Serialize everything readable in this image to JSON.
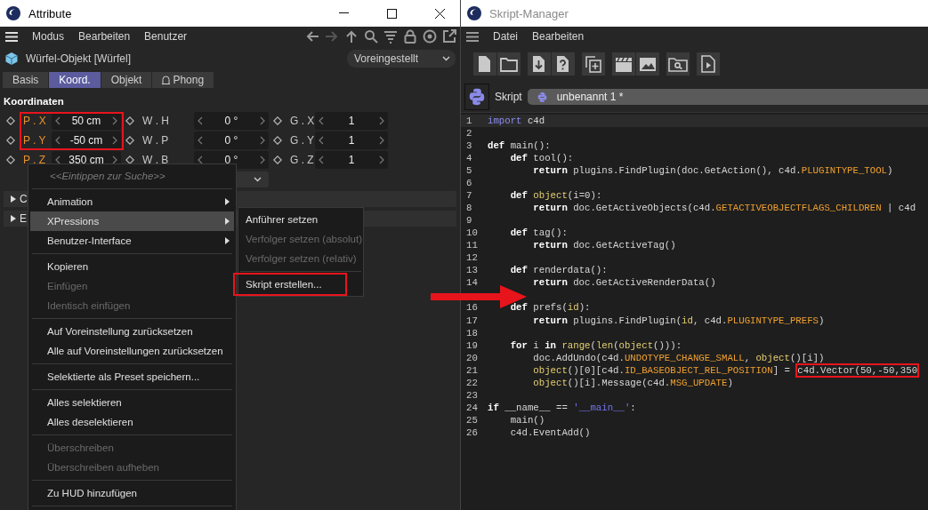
{
  "attribute_window": {
    "title": "Attribute",
    "menu": [
      "Modus",
      "Bearbeiten",
      "Benutzer"
    ],
    "object_title": "Würfel-Objekt [Würfel]",
    "preset": "Voreingestellt",
    "tabs": [
      {
        "label": "Basis",
        "selected": false,
        "has_icon": false
      },
      {
        "label": "Koord.",
        "selected": true,
        "has_icon": false
      },
      {
        "label": "Objekt",
        "selected": false,
        "has_icon": false
      },
      {
        "label": "Phong",
        "selected": false,
        "has_icon": true
      }
    ],
    "section_title": "Koordinaten",
    "coordinates": [
      [
        {
          "label": "P . X",
          "value": "50 cm",
          "color": "#e8902a",
          "annotated": true
        },
        {
          "label": "W . H",
          "value": "0 °",
          "color": "#c8c8c8",
          "annotated": false
        },
        {
          "label": "G . X",
          "value": "1",
          "color": "#c8c8c8",
          "annotated": false
        }
      ],
      [
        {
          "label": "P . Y",
          "value": "-50 cm",
          "color": "#e8902a",
          "annotated": true
        },
        {
          "label": "W . P",
          "value": "0 °",
          "color": "#c8c8c8",
          "annotated": false
        },
        {
          "label": "G . Y",
          "value": "1",
          "color": "#c8c8c8",
          "annotated": false
        }
      ],
      [
        {
          "label": "P . Z",
          "value": "350 cm",
          "color": "#e8902a",
          "annotated": false
        },
        {
          "label": "W . B",
          "value": "0 °",
          "color": "#c8c8c8",
          "annotated": false
        },
        {
          "label": "G . Z",
          "value": "1",
          "color": "#c8c8c8",
          "annotated": false
        }
      ]
    ],
    "groups": [
      {
        "label": "C",
        "expanded": false
      },
      {
        "label": "E",
        "expanded": false
      }
    ]
  },
  "context_menu": {
    "items": [
      {
        "kind": "search",
        "placeholder": "<<Eintippen zur Suche>>"
      },
      {
        "kind": "separator"
      },
      {
        "kind": "item",
        "label": "Animation",
        "submenu": true,
        "selected": false,
        "disabled": false
      },
      {
        "kind": "item",
        "label": "XPressions",
        "submenu": true,
        "selected": true,
        "disabled": false
      },
      {
        "kind": "item",
        "label": "Benutzer-Interface",
        "submenu": true,
        "selected": false,
        "disabled": false
      },
      {
        "kind": "separator"
      },
      {
        "kind": "item",
        "label": "Kopieren",
        "submenu": false,
        "selected": false,
        "disabled": false
      },
      {
        "kind": "item",
        "label": "Einfügen",
        "submenu": false,
        "selected": false,
        "disabled": true
      },
      {
        "kind": "item",
        "label": "Identisch einfügen",
        "submenu": false,
        "selected": false,
        "disabled": true
      },
      {
        "kind": "separator"
      },
      {
        "kind": "item",
        "label": "Auf Voreinstellung zurücksetzen",
        "submenu": false,
        "selected": false,
        "disabled": false
      },
      {
        "kind": "item",
        "label": "Alle auf Voreinstellungen zurücksetzen",
        "submenu": false,
        "selected": false,
        "disabled": false
      },
      {
        "kind": "separator"
      },
      {
        "kind": "item",
        "label": "Selektierte als Preset speichern...",
        "submenu": false,
        "selected": false,
        "disabled": false
      },
      {
        "kind": "separator"
      },
      {
        "kind": "item",
        "label": "Alles selektieren",
        "submenu": false,
        "selected": false,
        "disabled": false
      },
      {
        "kind": "item",
        "label": "Alles deselektieren",
        "submenu": false,
        "selected": false,
        "disabled": false
      },
      {
        "kind": "separator"
      },
      {
        "kind": "item",
        "label": "Überschreiben",
        "submenu": false,
        "selected": false,
        "disabled": true
      },
      {
        "kind": "item",
        "label": "Überschreiben aufheben",
        "submenu": false,
        "selected": false,
        "disabled": true
      },
      {
        "kind": "separator"
      },
      {
        "kind": "item",
        "label": "Zu HUD hinzufügen",
        "submenu": false,
        "selected": false,
        "disabled": false
      },
      {
        "kind": "separator"
      }
    ]
  },
  "submenu": {
    "items": [
      {
        "kind": "item",
        "label": "Anführer setzen",
        "disabled": false,
        "annotated": false
      },
      {
        "kind": "item",
        "label": "Verfolger setzen (absolut)",
        "disabled": true,
        "annotated": false
      },
      {
        "kind": "item",
        "label": "Verfolger setzen (relativ)",
        "disabled": true,
        "annotated": false
      },
      {
        "kind": "separator"
      },
      {
        "kind": "item",
        "label": "Skript erstellen...",
        "disabled": false,
        "annotated": true
      }
    ]
  },
  "script_window": {
    "title": "Skript-Manager",
    "menu": [
      "Datei",
      "Bearbeiten"
    ],
    "script_label": "Skript",
    "script_name": "unbenannt 1 *",
    "lines": [
      {
        "number": "1",
        "current": true,
        "tokens": [
          {
            "kind": "module",
            "text": "import"
          },
          {
            "kind": "plain",
            "text": " c4d"
          }
        ]
      },
      {
        "number": "2",
        "current": false
      },
      {
        "number": "3",
        "current": false,
        "tokens": [
          {
            "kind": "keyword",
            "text": "def"
          },
          {
            "kind": "plain",
            "text": " main():"
          }
        ]
      },
      {
        "number": "4",
        "current": false,
        "tokens": [
          {
            "kind": "keyword",
            "text": "    def"
          },
          {
            "kind": "plain",
            "text": " tool():"
          }
        ]
      },
      {
        "number": "5",
        "current": false,
        "tokens": [
          {
            "kind": "keyword",
            "text": "        return"
          },
          {
            "kind": "plain",
            "text": " plugins.FindPlugin(doc.GetAction(), c4d."
          },
          {
            "kind": "constant",
            "text": "PLUGINTYPE_TOOL"
          },
          {
            "kind": "plain",
            "text": ")"
          }
        ]
      },
      {
        "number": "6",
        "current": false
      },
      {
        "number": "7",
        "current": false,
        "tokens": [
          {
            "kind": "keyword",
            "text": "    def"
          },
          {
            "kind": "builtin",
            "text": " object"
          },
          {
            "kind": "plain",
            "text": "(i=0):"
          }
        ]
      },
      {
        "number": "8",
        "current": false,
        "tokens": [
          {
            "kind": "keyword",
            "text": "        return"
          },
          {
            "kind": "plain",
            "text": " doc.GetActiveObjects(c4d."
          },
          {
            "kind": "constant",
            "text": "GETACTIVEOBJECTFLAGS_CHILDREN"
          },
          {
            "kind": "plain",
            "text": " | c4d"
          }
        ]
      },
      {
        "number": "9",
        "current": false
      },
      {
        "number": "10",
        "current": false,
        "tokens": [
          {
            "kind": "keyword",
            "text": "    def"
          },
          {
            "kind": "plain",
            "text": " tag():"
          }
        ]
      },
      {
        "number": "11",
        "current": false,
        "tokens": [
          {
            "kind": "keyword",
            "text": "        return"
          },
          {
            "kind": "plain",
            "text": " doc.GetActiveTag()"
          }
        ]
      },
      {
        "number": "12",
        "current": false
      },
      {
        "number": "13",
        "current": false,
        "tokens": [
          {
            "kind": "keyword",
            "text": "    def"
          },
          {
            "kind": "plain",
            "text": " renderdata():"
          }
        ]
      },
      {
        "number": "14",
        "current": false,
        "tokens": [
          {
            "kind": "keyword",
            "text": "        return"
          },
          {
            "kind": "plain",
            "text": " doc.GetActiveRenderData()"
          }
        ]
      },
      {
        "current": false
      },
      {
        "number": "16",
        "current": false,
        "tokens": [
          {
            "kind": "keyword",
            "text": "    def"
          },
          {
            "kind": "plain",
            "text": " prefs("
          },
          {
            "kind": "builtin",
            "text": "id"
          },
          {
            "kind": "plain",
            "text": "):"
          }
        ]
      },
      {
        "number": "17",
        "current": false,
        "tokens": [
          {
            "kind": "keyword",
            "text": "        return"
          },
          {
            "kind": "plain",
            "text": " plugins.FindPlugin("
          },
          {
            "kind": "builtin",
            "text": "id"
          },
          {
            "kind": "plain",
            "text": ", c4d."
          },
          {
            "kind": "constant",
            "text": "PLUGINTYPE_PREFS"
          },
          {
            "kind": "plain",
            "text": ")"
          }
        ]
      },
      {
        "number": "18",
        "current": false
      },
      {
        "number": "19",
        "current": false,
        "tokens": [
          {
            "kind": "keyword",
            "text": "    for"
          },
          {
            "kind": "plain",
            "text": " i "
          },
          {
            "kind": "keyword",
            "text": "in"
          },
          {
            "kind": "builtin",
            "text": " range"
          },
          {
            "kind": "plain",
            "text": "("
          },
          {
            "kind": "builtin",
            "text": "len"
          },
          {
            "kind": "plain",
            "text": "("
          },
          {
            "kind": "builtin",
            "text": "object"
          },
          {
            "kind": "plain",
            "text": "())):"
          }
        ]
      },
      {
        "number": "20",
        "current": false,
        "tokens": [
          {
            "kind": "plain",
            "text": "        doc.AddUndo(c4d."
          },
          {
            "kind": "constant",
            "text": "UNDOTYPE_CHANGE_SMALL"
          },
          {
            "kind": "plain",
            "text": ", "
          },
          {
            "kind": "builtin",
            "text": "object"
          },
          {
            "kind": "plain",
            "text": "()[i])"
          }
        ]
      },
      {
        "number": "21",
        "current": false,
        "tokens": [
          {
            "kind": "builtin",
            "text": "        object"
          },
          {
            "kind": "plain",
            "text": "()[0][c4d."
          },
          {
            "kind": "constant",
            "text": "ID_BASEOBJECT_REL_POSITION"
          },
          {
            "kind": "plain",
            "text": "] = "
          },
          {
            "kind": "plain",
            "text": "c4d.Vector(50,-50,350",
            "annotated": true
          }
        ]
      },
      {
        "number": "22",
        "current": false,
        "tokens": [
          {
            "kind": "builtin",
            "text": "        object"
          },
          {
            "kind": "plain",
            "text": "()[i].Message(c4d."
          },
          {
            "kind": "constant",
            "text": "MSG_UPDATE"
          },
          {
            "kind": "plain",
            "text": ")"
          }
        ]
      },
      {
        "number": "23",
        "current": false
      },
      {
        "number": "24",
        "current": false,
        "tokens": [
          {
            "kind": "keyword",
            "text": "if"
          },
          {
            "kind": "plain",
            "text": " __name__ == "
          },
          {
            "kind": "string",
            "text": "'__main__'"
          },
          {
            "kind": "plain",
            "text": ":"
          }
        ]
      },
      {
        "number": "25",
        "current": false,
        "tokens": [
          {
            "kind": "plain",
            "text": "    main()"
          }
        ]
      },
      {
        "number": "26",
        "current": false,
        "tokens": [
          {
            "kind": "plain",
            "text": "    c4d.EventAdd()"
          }
        ]
      }
    ]
  },
  "callout_arrow": true
}
